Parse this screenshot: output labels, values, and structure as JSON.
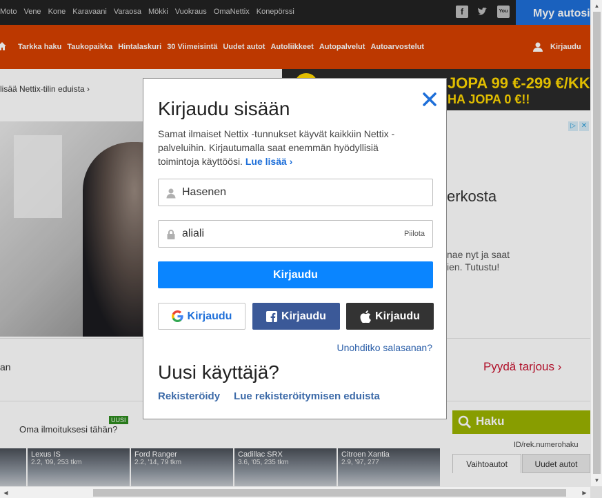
{
  "top_links": [
    "Moto",
    "Vene",
    "Kone",
    "Karavaani",
    "Varaosa",
    "Mökki",
    "Vuokraus",
    "OmaNettix",
    "Konepörssi"
  ],
  "social_icons": [
    "facebook-icon",
    "twitter-icon",
    "youtube-icon"
  ],
  "sell_button": "Myy autosi",
  "nav_links": [
    "Tarkka haku",
    "Taukopaikka",
    "Hintalaskuri",
    "30 Viimeisintä",
    "Uudet autot",
    "Autoliikkeet",
    "Autopalvelut",
    "Autoarvostelut"
  ],
  "nav_login": "Kirjaudu",
  "info_line": "lisää Nettix-tilin eduista",
  "banner": {
    "line1": "JOPA 99 €-299 €/KK",
    "line2": "HA JOPA 0 €!!"
  },
  "ad": {
    "heading": "erkosta",
    "text1": "nae nyt ja saat",
    "text2": "ien. Tutustu!"
  },
  "row_text": "an",
  "request_offer": "Pyydä tarjous",
  "own_ad": {
    "label": "Oma ilmoituksesi tähän?",
    "badge": "UUSI"
  },
  "cars": [
    {
      "name": "",
      "meta": ""
    },
    {
      "name": "Lexus IS",
      "meta": "2.2, '09, 253 tkm"
    },
    {
      "name": "Ford Ranger",
      "meta": "2.2, '14, 79 tkm"
    },
    {
      "name": "Cadillac SRX",
      "meta": "3.6, '05, 235 tkm"
    },
    {
      "name": "Citroen Xantia",
      "meta": "2.9, '97, 277"
    }
  ],
  "search": {
    "title": "Haku",
    "id_hint": "ID/rek.numerohaku",
    "tabs": [
      "Vaihtoautot",
      "Uudet autot"
    ]
  },
  "modal": {
    "title": "Kirjaudu sisään",
    "description": "Samat ilmaiset Nettix -tunnukset käyvät kaikkiin Nettix -palveluihin. Kirjautumalla saat enemmän hyödyllisiä toimintoja käyttöösi.",
    "read_more": "Lue lisää",
    "username_value": "Hasenen",
    "password_value": "aliali",
    "show_password": "Piilota",
    "submit": "Kirjaudu",
    "google_login": "Kirjaudu",
    "facebook_login": "Kirjaudu",
    "apple_login": "Kirjaudu",
    "forgot": "Unohditko salasanan?",
    "new_user_title": "Uusi käyttäjä?",
    "register": "Rekisteröidy",
    "register_benefits": "Lue rekisteröitymisen eduista"
  },
  "colors": {
    "accent": "#0a85ff",
    "nav": "#d64000",
    "facebook": "#3b5998",
    "apple": "#333333",
    "link": "#3c6aa8"
  }
}
